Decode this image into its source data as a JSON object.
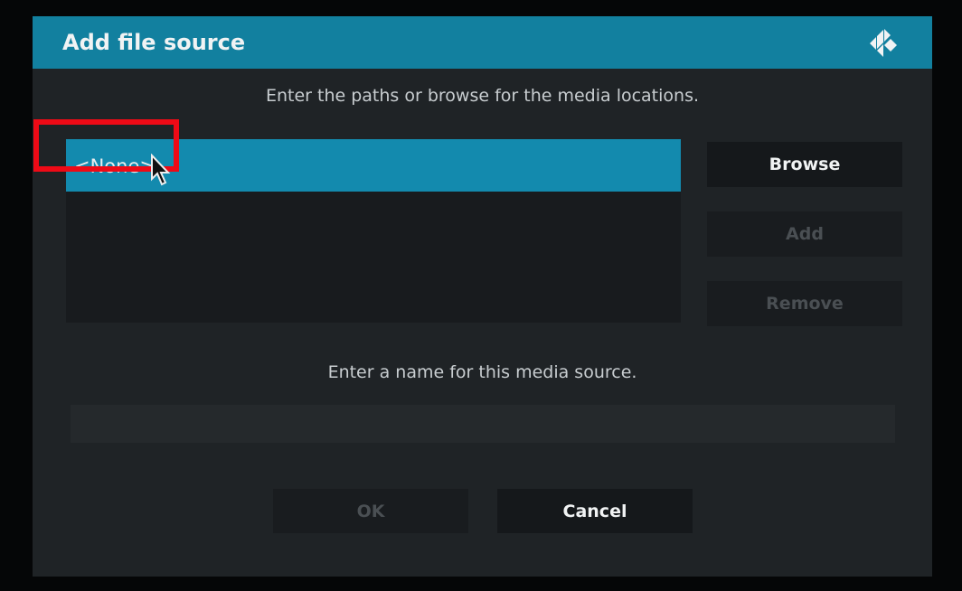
{
  "dialog": {
    "title": "Add file source",
    "logo_icon": "kodi-logo-icon"
  },
  "paths": {
    "instruction": "Enter the paths or browse for the media locations.",
    "items": [
      "<None>"
    ],
    "selected_index": 0
  },
  "side_buttons": {
    "browse": "Browse",
    "add": "Add",
    "remove": "Remove"
  },
  "name": {
    "instruction": "Enter a name for this media source.",
    "value": ""
  },
  "footer": {
    "ok": "OK",
    "cancel": "Cancel"
  },
  "colors": {
    "accent": "#12809f",
    "highlight_box": "#ee0a16",
    "dialog_bg": "#1f2326"
  }
}
